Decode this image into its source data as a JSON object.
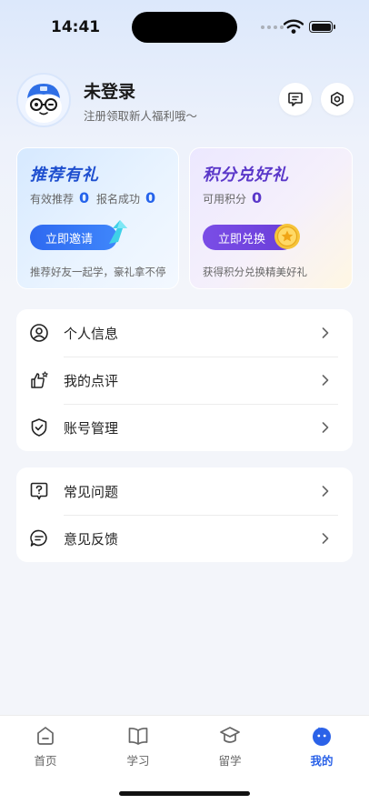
{
  "status_bar": {
    "time": "14:41"
  },
  "profile": {
    "name": "未登录",
    "subtitle": "注册领取新人福利哦～"
  },
  "cards": {
    "referral": {
      "title": "推荐有礼",
      "stat1_label": "有效推荐",
      "stat1_value": "0",
      "stat2_label": "报名成功",
      "stat2_value": "0",
      "button": "立即邀请",
      "footer": "推荐好友一起学，豪礼拿不停"
    },
    "points": {
      "title": "积分兑好礼",
      "stat_label": "可用积分",
      "stat_value": "0",
      "button": "立即兑换",
      "footer": "获得积分兑换精美好礼"
    }
  },
  "menu_group_1": [
    {
      "label": "个人信息",
      "icon": "person-circle-icon"
    },
    {
      "label": "我的点评",
      "icon": "thumbs-up-star-icon"
    },
    {
      "label": "账号管理",
      "icon": "shield-check-icon"
    }
  ],
  "menu_group_2": [
    {
      "label": "常见问题",
      "icon": "question-bubble-icon"
    },
    {
      "label": "意见反馈",
      "icon": "feedback-bubble-icon"
    }
  ],
  "tabbar": {
    "tabs": [
      {
        "label": "首页",
        "icon": "home-icon"
      },
      {
        "label": "学习",
        "icon": "book-icon"
      },
      {
        "label": "留学",
        "icon": "graduation-cap-icon"
      },
      {
        "label": "我的",
        "icon": "mascot-icon"
      }
    ],
    "active_index": 3
  },
  "colors": {
    "accent_blue": "#2b62e8",
    "accent_purple": "#5a37c9"
  }
}
